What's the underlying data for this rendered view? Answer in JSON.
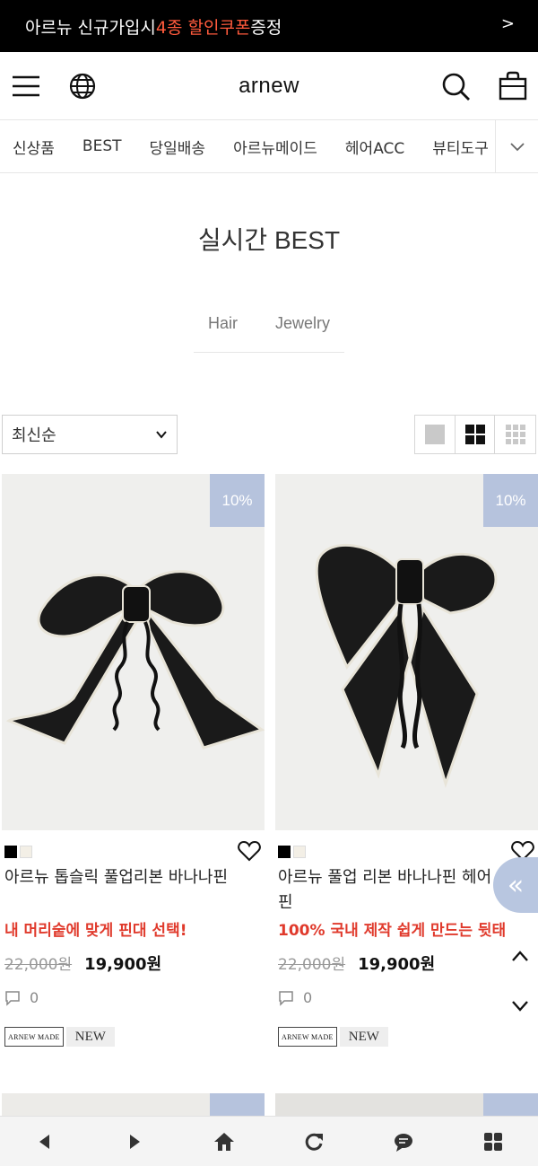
{
  "promo": {
    "prefix": "아르뉴 신규가입시 ",
    "highlight": "4종 할인쿠폰",
    "suffix": " 증정",
    "arrow": ">",
    "highlight_color": "#ff5a3c"
  },
  "header": {
    "logo": "arnew",
    "icons": [
      "menu-icon",
      "globe-icon",
      "search-icon",
      "shopping-bag-icon"
    ]
  },
  "category_nav": {
    "items": [
      "신상품",
      "BEST",
      "당일배송",
      "아르뉴메이드",
      "헤어ACC",
      "뷰티도구"
    ]
  },
  "page": {
    "title": "실시간 BEST",
    "tabs": [
      "Hair",
      "Jewelry"
    ]
  },
  "toolbar": {
    "sort_selected": "최신순",
    "view_options": [
      "single-view-icon",
      "grid-2-view-icon",
      "grid-3-view-icon"
    ],
    "active_view": "grid-2-view-icon"
  },
  "products": [
    {
      "badge": "10%",
      "swatch_colors": [
        "#000000",
        "#f3efe6"
      ],
      "name": "아르뉴 톱슬릭 풀업리본 바나나핀",
      "description": "내 머리숱에 맞게 핀대 선택!",
      "original_price": "22,000원",
      "sale_price": "19,900원",
      "review_count": "0",
      "tag_made": "ARNEW MADE",
      "tag_new": "NEW"
    },
    {
      "badge": "10%",
      "swatch_colors": [
        "#000000",
        "#f3efe6"
      ],
      "name": "아르뉴 풀업 리본 바나나핀 헤어핀",
      "description": "100% 국내 제작 쉽게 만드는 뒷태",
      "original_price": "22,000원",
      "sale_price": "19,900원",
      "review_count": "0",
      "tag_made": "ARNEW MADE",
      "tag_new": "NEW"
    }
  ],
  "floating": {
    "side_icon": "double-chevron-left-icon",
    "side_glyph": "«"
  },
  "browser_bar": {
    "icons": [
      "back-icon",
      "forward-icon",
      "home-icon",
      "refresh-icon",
      "chat-icon",
      "apps-icon"
    ]
  },
  "colors": {
    "badge": "#b6c3dd",
    "description_red": "#e03a2c"
  }
}
